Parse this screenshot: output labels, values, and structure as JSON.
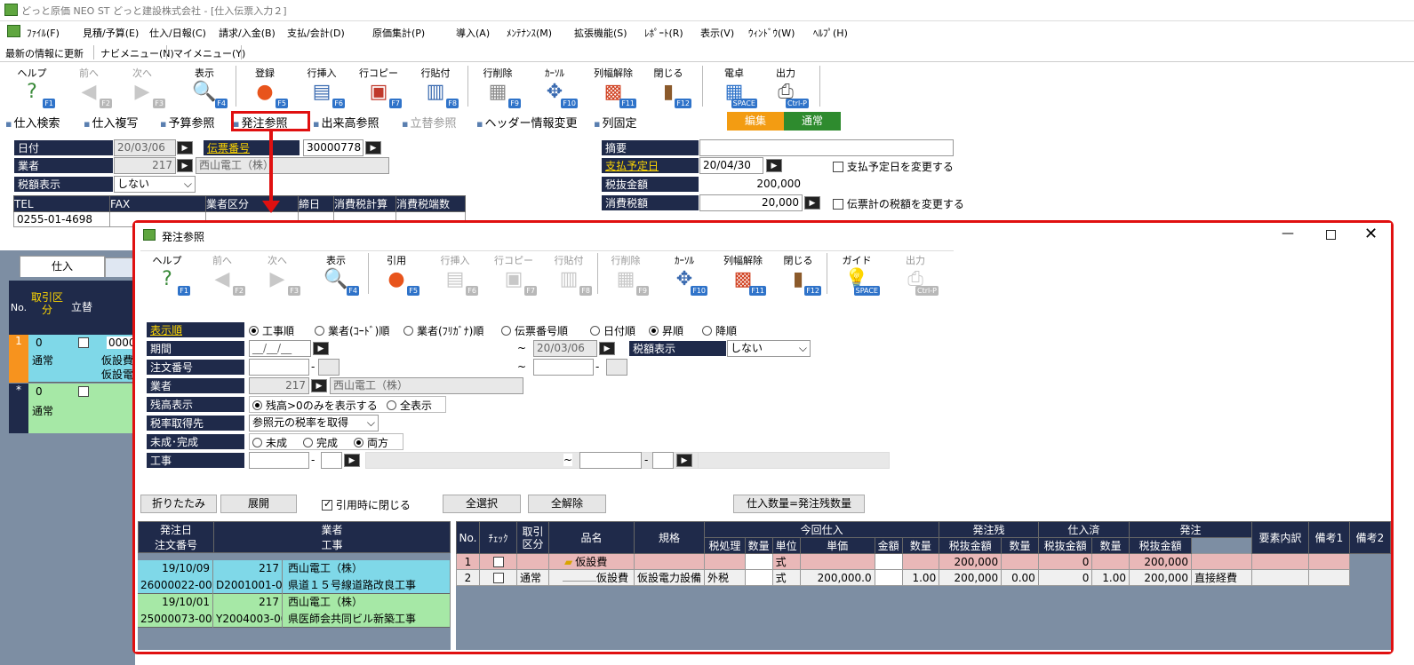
{
  "window": {
    "title": "どっと原価 NEO ST どっと建設株式会社 - [仕入伝票入力２]"
  },
  "menu": [
    "ﾌｧｲﾙ(F)",
    "見積/予算(E)",
    "仕入/日報(C)",
    "請求/入金(B)",
    "支払/会計(D)",
    "原価集計(P)",
    "導入(A)",
    "ﾒﾝﾃﾅﾝｽ(M)",
    "拡張機能(S)",
    "ﾚﾎﾟｰﾄ(R)",
    "表示(V)",
    "ｳｨﾝﾄﾞｳ(W)",
    "ﾍﾙﾌﾟ(H)"
  ],
  "toolrow": [
    "最新の情報に更新",
    "ナビメニュー(N)",
    "マイメニュー(Y)"
  ],
  "main_toolbar": [
    {
      "label": "ヘルプ",
      "key": "F1",
      "icon": "help-icon",
      "enabled": true
    },
    {
      "label": "前へ",
      "key": "F2",
      "icon": "prev-icon",
      "enabled": false
    },
    {
      "label": "次へ",
      "key": "F3",
      "icon": "next-icon",
      "enabled": false
    },
    {
      "label": "表示",
      "key": "F4",
      "icon": "search-icon",
      "enabled": true
    },
    {
      "label": "登録",
      "key": "F5",
      "icon": "ok-icon",
      "enabled": true
    },
    {
      "label": "行挿入",
      "key": "F6",
      "icon": "row-insert-icon",
      "enabled": true
    },
    {
      "label": "行コピー",
      "key": "F7",
      "icon": "row-copy-icon",
      "enabled": true
    },
    {
      "label": "行貼付",
      "key": "F8",
      "icon": "row-paste-icon",
      "enabled": true
    },
    {
      "label": "行削除",
      "key": "F9",
      "icon": "row-delete-icon",
      "enabled": true
    },
    {
      "label": "ｶｰｿﾙ",
      "key": "F10",
      "icon": "cursor-icon",
      "enabled": true
    },
    {
      "label": "列幅解除",
      "key": "F11",
      "icon": "column-width-icon",
      "enabled": true
    },
    {
      "label": "閉じる",
      "key": "F12",
      "icon": "close-door-icon",
      "enabled": true
    },
    {
      "label": "電卓",
      "key": "SPACE",
      "icon": "calculator-icon",
      "enabled": true
    },
    {
      "label": "出力",
      "key": "Ctrl-P",
      "icon": "print-icon",
      "enabled": true
    }
  ],
  "link_bar": [
    "仕入検索",
    "仕入複写",
    "予算参照",
    "発注参照",
    "出来高参照",
    "立替参照",
    "ヘッダー情報変更",
    "列固定"
  ],
  "mode": {
    "edit": "編集",
    "normal": "通常",
    "edit_color": "#f39c12",
    "normal_color": "#2e8b2e"
  },
  "header": {
    "date_label": "日付",
    "date": "20/03/06",
    "slip_label": "伝票番号",
    "slip": "30000778",
    "vendor_label": "業者",
    "vendor_code": "217",
    "vendor_name": "西山電工（株）",
    "tax_disp_label": "税額表示",
    "tax_disp": "しない",
    "cols": [
      "TEL",
      "FAX",
      "業者区分",
      "締日",
      "消費税計算",
      "消費税端数"
    ],
    "tel": "0255-01-4698",
    "memo_label": "摘要",
    "pay_label": "支払予定日",
    "pay_date": "20/04/30",
    "pay_change": "支払予定日を変更する",
    "net_label": "税抜金額",
    "net": "200,000",
    "tax_label": "消費税額",
    "tax": "20,000",
    "tax_change": "伝票計の税額を変更する"
  },
  "left_grid": {
    "tab": "仕入",
    "headers": [
      "No.",
      "取引区分",
      "立替"
    ],
    "rows": [
      {
        "no": "1",
        "kind": "0",
        "kind2": "通常",
        "code": "0000",
        "t1": "仮設費",
        "t2": "仮設電"
      },
      {
        "no": "*",
        "kind": "0",
        "kind2": "通常"
      }
    ]
  },
  "dialog": {
    "title": "発注参照",
    "toolbar": [
      {
        "label": "ヘルプ",
        "key": "F1",
        "icon": "help-icon",
        "enabled": true
      },
      {
        "label": "前へ",
        "key": "F2",
        "icon": "prev-icon",
        "enabled": false
      },
      {
        "label": "次へ",
        "key": "F3",
        "icon": "next-icon",
        "enabled": false
      },
      {
        "label": "表示",
        "key": "F4",
        "icon": "search-icon",
        "enabled": true
      },
      {
        "label": "引用",
        "key": "F5",
        "icon": "ok-icon",
        "enabled": true
      },
      {
        "label": "行挿入",
        "key": "F6",
        "icon": "row-insert-icon",
        "enabled": false
      },
      {
        "label": "行コピー",
        "key": "F7",
        "icon": "row-copy-icon",
        "enabled": false
      },
      {
        "label": "行貼付",
        "key": "F8",
        "icon": "row-paste-icon",
        "enabled": false
      },
      {
        "label": "行削除",
        "key": "F9",
        "icon": "row-delete-icon",
        "enabled": false
      },
      {
        "label": "ｶｰｿﾙ",
        "key": "F10",
        "icon": "cursor-icon",
        "enabled": true
      },
      {
        "label": "列幅解除",
        "key": "F11",
        "icon": "column-width-icon",
        "enabled": true
      },
      {
        "label": "閉じる",
        "key": "F12",
        "icon": "close-door-icon",
        "enabled": true
      },
      {
        "label": "ガイド",
        "key": "SPACE",
        "icon": "guide-icon",
        "enabled": true
      },
      {
        "label": "出力",
        "key": "Ctrl-P",
        "icon": "print-icon",
        "enabled": false
      }
    ],
    "sort_label": "表示順",
    "sort_opts": [
      "工事順",
      "業者(ｺｰﾄﾞ)順",
      "業者(ﾌﾘｶﾞﾅ)順",
      "伝票番号順",
      "日付順"
    ],
    "order_opts": [
      "昇順",
      "降順"
    ],
    "period_label": "期間",
    "period_from": "__/__/__",
    "period_to": "20/03/06",
    "taxdisp_label": "税額表示",
    "taxdisp": "しない",
    "order_no_label": "注文番号",
    "vendor_label": "業者",
    "vendor_code": "217",
    "vendor_name": "西山電工（株）",
    "balance_label": "残高表示",
    "balance_opts": [
      "残高>0のみを表示する",
      "全表示"
    ],
    "taxsrc_label": "税率取得先",
    "taxsrc": "参照元の税率を取得",
    "status_label": "未成･完成",
    "status_opts": [
      "未成",
      "完成",
      "両方"
    ],
    "project_label": "工事",
    "btn_fold": "折りたたみ",
    "btn_expand": "展開",
    "close_on_cite": "引用時に閉じる",
    "btn_select_all": "全選択",
    "btn_clear_all": "全解除",
    "btn_qty": "仕入数量=発注残数量",
    "left_headers": [
      "発注日",
      "業者",
      "注文番号",
      "工事"
    ],
    "left_rows": [
      {
        "date": "19/10/09",
        "vcode": "217",
        "vname": "西山電工（株）",
        "order": "26000022-00",
        "pcode": "D2001001-00",
        "pname": "県道１５号線道路改良工事"
      },
      {
        "date": "19/10/01",
        "vcode": "217",
        "vname": "西山電工（株）",
        "order": "25000073-00",
        "pcode": "Y2004003-00",
        "pname": "県医師会共同ビル新築工事"
      }
    ],
    "grid_headers": {
      "no": "No.",
      "check": "ﾁｪｯｸ",
      "kind": "取引区分",
      "item": "品名",
      "spec": "規格",
      "cur": "今回仕入",
      "tax": "税処理",
      "qty": "数量",
      "unit": "単位",
      "price": "単価",
      "amount": "金額",
      "remain": "発注残",
      "rqty": "数量",
      "ramt": "税抜金額",
      "done": "仕入済",
      "dqty": "数量",
      "damt": "税抜金額",
      "order": "発注",
      "oqty": "数量",
      "oamt": "税抜金額",
      "elem": "要素内訳",
      "note1": "備考1",
      "note2": "備考2"
    },
    "grid_rows": [
      {
        "no": "1",
        "kind": "",
        "item": "仮設費",
        "spec": "",
        "tax": "",
        "qty": "",
        "unit": "式",
        "price": "",
        "amount": "",
        "rqty": "",
        "ramt": "200,000",
        "dqty": "",
        "damt": "0",
        "oqty": "",
        "oamt": "200,000",
        "elem": ""
      },
      {
        "no": "2",
        "kind": "通常",
        "item": "仮設費",
        "spec": "仮設電力設備",
        "tax": "外税",
        "qty": "",
        "unit": "式",
        "price": "200,000.0",
        "amount": "",
        "rqty": "1.00",
        "ramt": "200,000",
        "dqty": "0.00",
        "damt": "0",
        "oqty": "1.00",
        "oamt": "200,000",
        "elem": "直接経費"
      }
    ]
  }
}
